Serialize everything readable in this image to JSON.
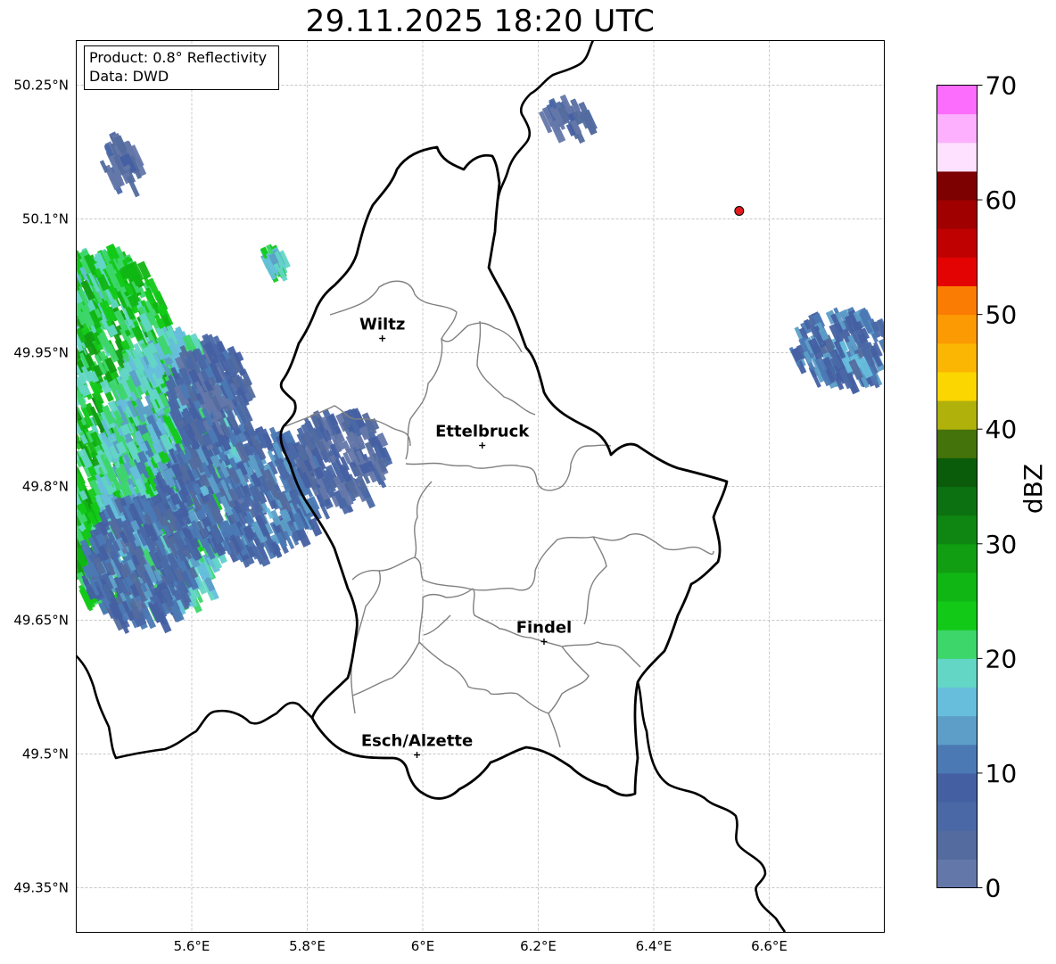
{
  "title": "29.11.2025 18:20 UTC",
  "info_box": {
    "product": "Product: 0.8° Reflectivity",
    "data": "Data: DWD"
  },
  "chart_data": {
    "type": "heatmap",
    "title": "29.11.2025 18:20 UTC",
    "projection": "PlateCarree",
    "xlim": [
      5.4,
      6.8
    ],
    "ylim": [
      49.3,
      50.3
    ],
    "gridlines": true,
    "lon_ticks": [
      {
        "value": 5.6,
        "label": "5.6°E"
      },
      {
        "value": 5.8,
        "label": "5.8°E"
      },
      {
        "value": 6.0,
        "label": "6°E"
      },
      {
        "value": 6.2,
        "label": "6.2°E"
      },
      {
        "value": 6.4,
        "label": "6.4°E"
      },
      {
        "value": 6.6,
        "label": "6.6°E"
      }
    ],
    "lat_ticks": [
      {
        "value": 50.25,
        "label": "50.25°N"
      },
      {
        "value": 50.1,
        "label": "50.1°N"
      },
      {
        "value": 49.95,
        "label": "49.95°N"
      },
      {
        "value": 49.8,
        "label": "49.8°N"
      },
      {
        "value": 49.65,
        "label": "49.65°N"
      },
      {
        "value": 49.5,
        "label": "49.5°N"
      },
      {
        "value": 49.35,
        "label": "49.35°N"
      }
    ],
    "cities": [
      {
        "name": "Wiltz",
        "lon": 5.93,
        "lat": 49.966
      },
      {
        "name": "Ettelbruck",
        "lon": 6.103,
        "lat": 49.846
      },
      {
        "name": "Findel",
        "lon": 6.21,
        "lat": 49.626
      },
      {
        "name": "Esch/Alzette",
        "lon": 5.99,
        "lat": 49.499
      }
    ],
    "radar_site": {
      "lon": 6.548,
      "lat": 50.109,
      "color": "#e41a1c"
    },
    "colorbar": {
      "label": "dBZ",
      "min": 0,
      "max": 70,
      "step": 2.5,
      "ticks": [
        0,
        10,
        20,
        30,
        40,
        50,
        60,
        70
      ],
      "colors": [
        "#6477a9",
        "#536b9e",
        "#4a68a6",
        "#4560a2",
        "#4b79b4",
        "#5c9ec8",
        "#66bedc",
        "#63d6c6",
        "#3dd66a",
        "#12c917",
        "#10b613",
        "#119e12",
        "#0e8611",
        "#0c7111",
        "#0a5c0a",
        "#44730b",
        "#b0b10b",
        "#fbd600",
        "#fbb503",
        "#fb9a02",
        "#fb7c03",
        "#e40303",
        "#c00101",
        "#a00000",
        "#7c0100",
        "#fee1fe",
        "#fdb0fd",
        "#fd6dfd",
        "#e930e9"
      ]
    },
    "echo_cells": [
      {
        "lon": 5.45,
        "lat": 49.87,
        "dlon": 0.13,
        "dlat": 0.2,
        "dbz": 24
      },
      {
        "lon": 5.55,
        "lat": 49.82,
        "dlon": 0.12,
        "dlat": 0.16,
        "dbz": 18
      },
      {
        "lon": 5.68,
        "lat": 49.8,
        "dlon": 0.15,
        "dlat": 0.07,
        "dbz": 9
      },
      {
        "lon": 5.5,
        "lat": 49.72,
        "dlon": 0.1,
        "dlat": 0.07,
        "dbz": 8
      },
      {
        "lon": 5.85,
        "lat": 49.84,
        "dlon": 0.08,
        "dlat": 0.05,
        "dbz": 5
      },
      {
        "lon": 5.62,
        "lat": 49.91,
        "dlon": 0.07,
        "dlat": 0.06,
        "dbz": 6
      },
      {
        "lon": 6.72,
        "lat": 49.96,
        "dlon": 0.09,
        "dlat": 0.04,
        "dbz": 10
      },
      {
        "lon": 5.42,
        "lat": 50.03,
        "dlon": 0.05,
        "dlat": 0.04,
        "dbz": 22
      },
      {
        "lon": 5.73,
        "lat": 50.06,
        "dlon": 0.02,
        "dlat": 0.01,
        "dbz": 20
      },
      {
        "lon": 6.24,
        "lat": 50.22,
        "dlon": 0.04,
        "dlat": 0.02,
        "dbz": 4
      },
      {
        "lon": 5.47,
        "lat": 50.17,
        "dlon": 0.03,
        "dlat": 0.03,
        "dbz": 3
      }
    ]
  }
}
